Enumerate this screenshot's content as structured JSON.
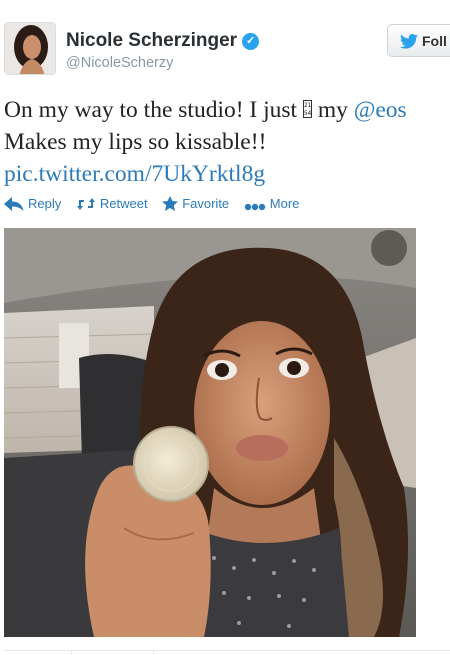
{
  "profile": {
    "name": "Nicole Scherzinger",
    "handle": "@NicoleScherzy",
    "verified_icon": "verified-badge-icon",
    "follow_label": "Foll"
  },
  "tweet": {
    "part1": "On my way to the studio! I just ",
    "glyph": "2 1\n5 4",
    "part2": " my ",
    "mention": "@eos",
    "line2": "Makes my lips so kissable!!",
    "link": "pic.twitter.com/7UkYrktl8g"
  },
  "actions": {
    "reply": "Reply",
    "retweet": "Retweet",
    "favorite": "Favorite",
    "more": "More"
  },
  "colors": {
    "link": "#2b7bb9",
    "verified": "#2aa3ef",
    "handle": "#8899a6"
  }
}
